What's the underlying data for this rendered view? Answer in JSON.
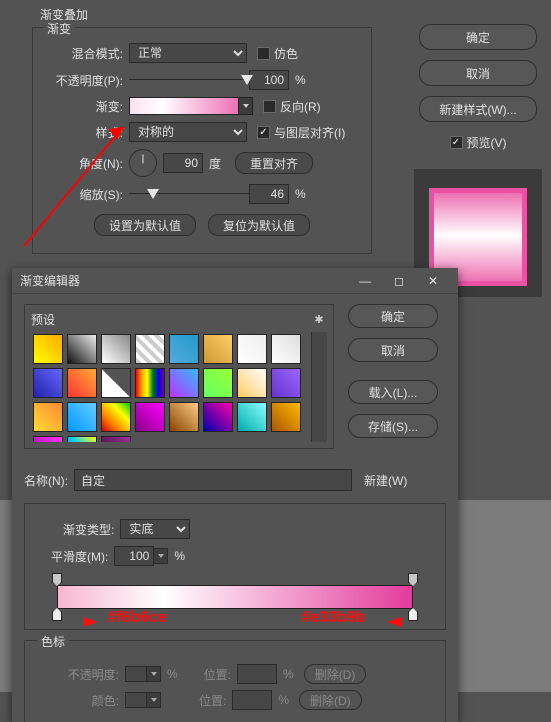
{
  "overlay": {
    "section_title": "渐变叠加",
    "fieldset_title": "渐变",
    "labels": {
      "blend_mode": "混合模式:",
      "opacity": "不透明度(P):",
      "gradient": "渐变:",
      "style": "样式:",
      "angle": "角度(N):",
      "scale": "缩放(S):",
      "degree": "度"
    },
    "values": {
      "blend_mode": "正常",
      "opacity": "100",
      "style": "对称的",
      "angle": "90",
      "scale": "46"
    },
    "checks": {
      "dither": "仿色",
      "reverse": "反向(R)",
      "align_layer": "与图层对齐(I)"
    },
    "buttons": {
      "reset_align": "重置对齐",
      "set_default": "设置为默认值",
      "reset_default": "复位为默认值"
    },
    "percent": "%"
  },
  "right": {
    "ok": "确定",
    "cancel": "取消",
    "new_style": "新建样式(W)...",
    "preview": "预览(V)"
  },
  "editor": {
    "title": "渐变编辑器",
    "presets_label": "预设",
    "ok": "确定",
    "cancel": "取消",
    "load": "载入(L)...",
    "save": "存储(S)...",
    "name_label": "名称(N):",
    "name_value": "自定",
    "new": "新建(W)",
    "type_label": "渐变类型:",
    "type_value": "实底",
    "smooth_label": "平滑度(M):",
    "smooth_value": "100",
    "percent": "%",
    "stops_title": "色标",
    "opacity_label": "不透明度:",
    "location_label": "位置:",
    "color_label": "颜色:",
    "delete": "删除(D)"
  },
  "annotations": {
    "left_hex": "#f6b6ce",
    "right_hex": "#e33b9b"
  },
  "preset_colors": [
    "linear-gradient(45deg,#ff0,#fa0)",
    "linear-gradient(45deg,#111,#eee)",
    "linear-gradient(45deg,#fff,#888)",
    "repeating-linear-gradient(45deg,#ccc 0 4px,#fff 4px 8px)",
    "linear-gradient(45deg,#5ad,#29c)",
    "linear-gradient(45deg,#c93,#fc6)",
    "linear-gradient(45deg,#fff,#eee)",
    "linear-gradient(45deg,#fff,#ddd)",
    "linear-gradient(45deg,#22a,#66f)",
    "linear-gradient(45deg,#f33,#fa3)",
    "linear-gradient(45deg,#fff 0,#fff 50%,transparent 50%)",
    "linear-gradient(90deg,red,orange,yellow,green,blue,purple)",
    "linear-gradient(45deg,#b3f,#3bf)",
    "linear-gradient(45deg,#6f6,#9f3)",
    "linear-gradient(45deg,#fc6,#fff)",
    "linear-gradient(45deg,#63c,#96f)",
    "linear-gradient(45deg,#fd3,#f83)",
    "linear-gradient(45deg,#09f,#6cf)",
    "linear-gradient(45deg,#c00,#f80,#ff0,#0c0)",
    "linear-gradient(45deg,#808,#f0f)",
    "linear-gradient(45deg,#840,#fc8)",
    "linear-gradient(45deg,#00a,#f0a)",
    "linear-gradient(45deg,#0aa,#8ff)",
    "linear-gradient(45deg,#a50,#fb0)",
    "linear-gradient(45deg,#909,#f3f)",
    "linear-gradient(45deg,#06c,#0cf,#ff0)",
    "linear-gradient(45deg,#303,#939)"
  ]
}
